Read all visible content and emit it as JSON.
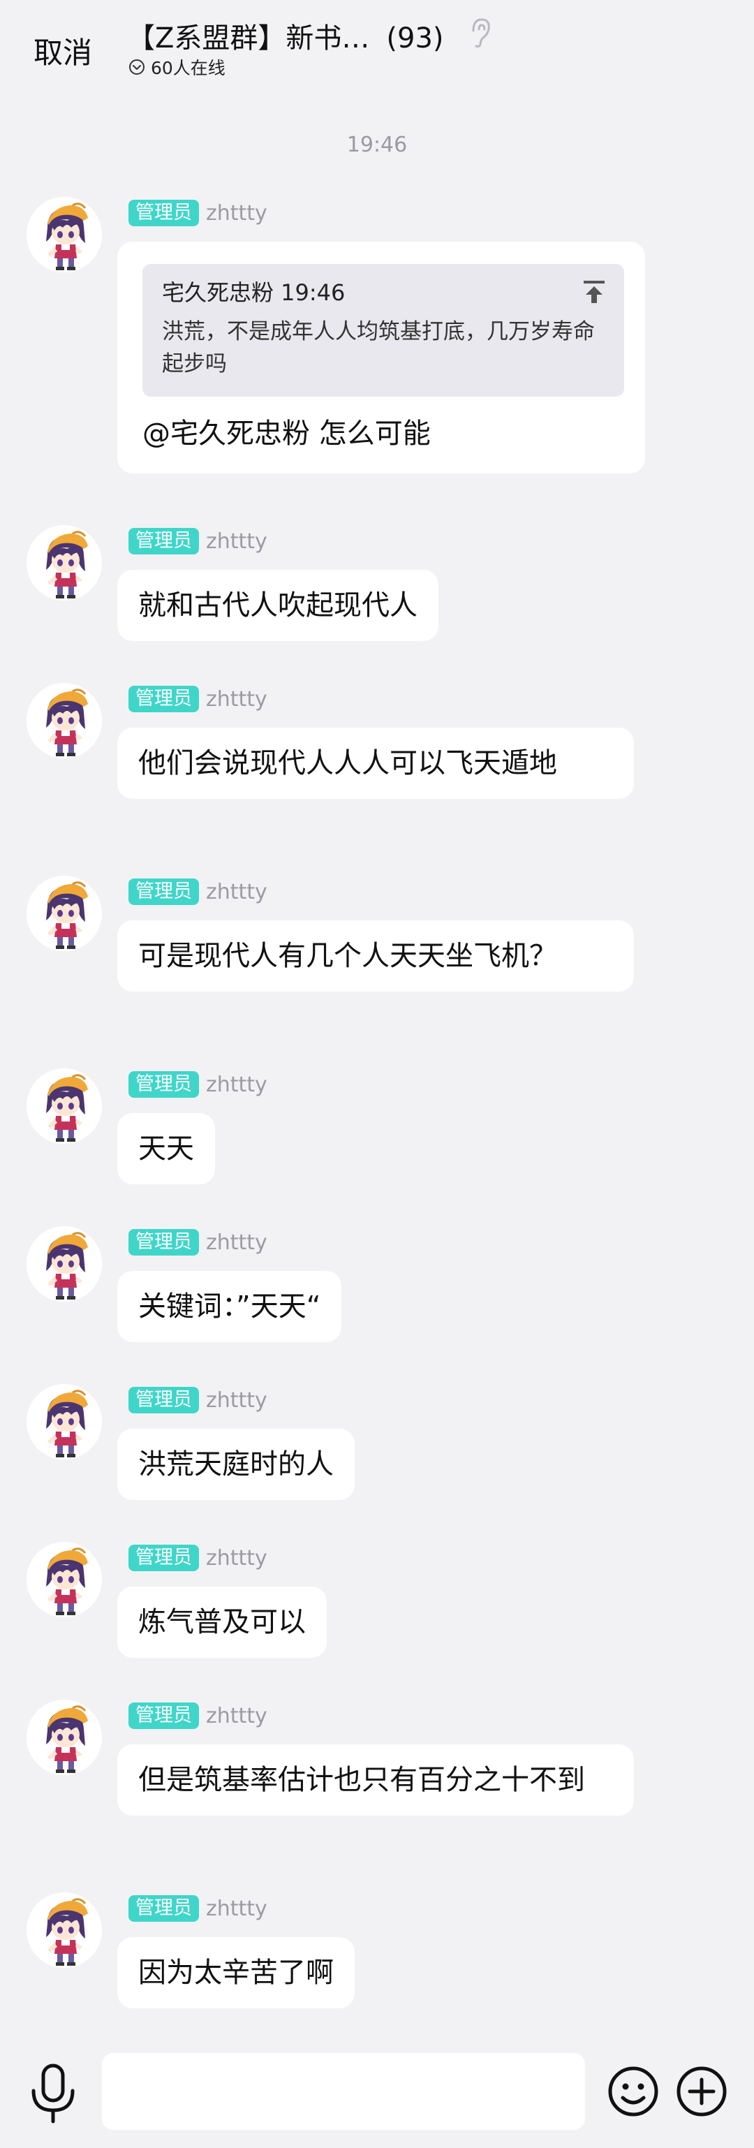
{
  "header": {
    "cancel_label": "取消",
    "title": "【Z系盟群】新书…",
    "member_count": "(93)",
    "online_text": "60人在线"
  },
  "timestamp": "19:46",
  "input": {
    "placeholder": ""
  },
  "messages": [
    {
      "badge": "管理员",
      "user": "zhttty",
      "quote": {
        "header": "宅久死忠粉 19:46",
        "text": "洪荒，不是成年人人均筑基打底，几万岁寿命起步吗"
      },
      "text": "@宅久死忠粉 怎么可能"
    },
    {
      "badge": "管理员",
      "user": "zhttty",
      "text": "就和古代人吹起现代人"
    },
    {
      "badge": "管理员",
      "user": "zhttty",
      "text": "他们会说现代人人人可以飞天遁地"
    },
    {
      "badge": "管理员",
      "user": "zhttty",
      "text": "可是现代人有几个人天天坐飞机？"
    },
    {
      "badge": "管理员",
      "user": "zhttty",
      "text": "天天"
    },
    {
      "badge": "管理员",
      "user": "zhttty",
      "text": "关键词：”天天“"
    },
    {
      "badge": "管理员",
      "user": "zhttty",
      "text": "洪荒天庭时的人"
    },
    {
      "badge": "管理员",
      "user": "zhttty",
      "text": "炼气普及可以"
    },
    {
      "badge": "管理员",
      "user": "zhttty",
      "text": "但是筑基率估计也只有百分之十不到"
    },
    {
      "badge": "管理员",
      "user": "zhttty",
      "text": "因为太辛苦了啊"
    }
  ]
}
